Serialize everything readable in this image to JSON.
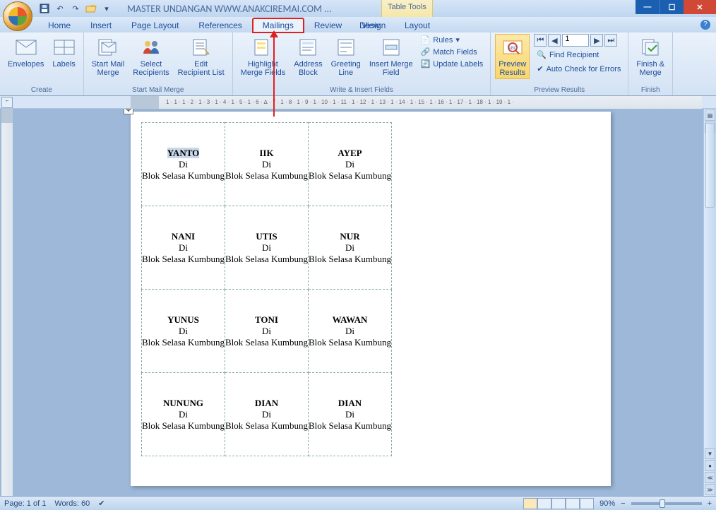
{
  "title": "MASTER UNDANGAN WWW.ANAKCIREMAI.COM ...",
  "contextual_tab_title": "Table Tools",
  "tabs": [
    "Home",
    "Insert",
    "Page Layout",
    "References",
    "Mailings",
    "Review",
    "View",
    "Design",
    "Layout"
  ],
  "active_tab": "Mailings",
  "ribbon": {
    "groups": [
      {
        "label": "Create",
        "items": [
          "Envelopes",
          "Labels"
        ]
      },
      {
        "label": "Start Mail Merge",
        "items": [
          "Start Mail\nMerge",
          "Select\nRecipients",
          "Edit\nRecipient List"
        ]
      },
      {
        "label": "Write & Insert Fields",
        "items": [
          "Highlight\nMerge Fields",
          "Address\nBlock",
          "Greeting\nLine",
          "Insert Merge\nField"
        ],
        "small": [
          "Rules",
          "Match Fields",
          "Update Labels"
        ]
      },
      {
        "label": "Preview Results",
        "preview_btn": "Preview\nResults",
        "record": "1",
        "find": "Find Recipient",
        "autocheck": "Auto Check for Errors"
      },
      {
        "label": "Finish",
        "items": [
          "Finish &\nMerge"
        ]
      }
    ]
  },
  "ruler_text": "1 · 1 · 1 · 2 · 1 · 3 · 1 · 4 · 1 · 5 · 1 · 6 · ∆ · 7 · 1 · 8 · 1 · 9 · 1 · 10 · 1 · 11 · 1 · 12 · 1 · 13 · 1 · 14 · 1 · 15 · 1 · 16 · 1 · 17 · 1 · 18 · 1 · 19 · 1 ·",
  "labels": [
    {
      "name": "YANTO",
      "line2": "Di",
      "line3": "Blok Selasa Kumbung",
      "selected": true
    },
    {
      "name": "IIK",
      "line2": "Di",
      "line3": "Blok Selasa Kumbung"
    },
    {
      "name": "AYEP",
      "line2": "Di",
      "line3": "Blok Selasa Kumbung"
    },
    {
      "name": "NANI",
      "line2": "Di",
      "line3": "Blok Selasa Kumbung"
    },
    {
      "name": "UTIS",
      "line2": "Di",
      "line3": "Blok Selasa Kumbung"
    },
    {
      "name": "NUR",
      "line2": "Di",
      "line3": "Blok Selasa Kumbung"
    },
    {
      "name": "YUNUS",
      "line2": "Di",
      "line3": "Blok Selasa Kumbung"
    },
    {
      "name": "TONI",
      "line2": "Di",
      "line3": "Blok Selasa Kumbung"
    },
    {
      "name": "WAWAN",
      "line2": "Di",
      "line3": "Blok Selasa Kumbung"
    },
    {
      "name": "NUNUNG",
      "line2": "Di",
      "line3": "Blok Selasa Kumbung"
    },
    {
      "name": "DIAN",
      "line2": "Di",
      "line3": "Blok Selasa Kumbung"
    },
    {
      "name": "DIAN",
      "line2": "Di",
      "line3": "Blok Selasa Kumbung"
    }
  ],
  "status": {
    "page": "Page: 1 of 1",
    "words": "Words: 60",
    "zoom": "90%"
  }
}
